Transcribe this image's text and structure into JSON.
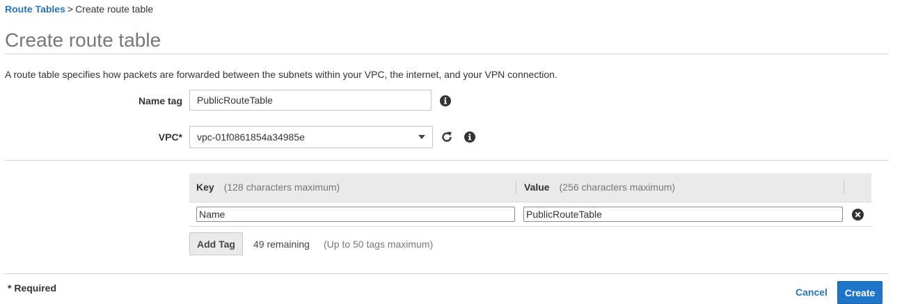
{
  "breadcrumb": {
    "parent": "Route Tables",
    "separator": ">",
    "current": "Create route table"
  },
  "page": {
    "title": "Create route table",
    "description": "A route table specifies how packets are forwarded between the subnets within your VPC, the internet, and your VPN connection."
  },
  "form": {
    "name_tag": {
      "label": "Name tag",
      "value": "PublicRouteTable"
    },
    "vpc": {
      "label": "VPC*",
      "selected": "vpc-01f0861854a34985e"
    }
  },
  "tags": {
    "key_header": "Key",
    "key_hint": "(128 characters maximum)",
    "value_header": "Value",
    "value_hint": "(256 characters maximum)",
    "rows": [
      {
        "key": "Name",
        "value": "PublicRouteTable"
      }
    ],
    "add_tag_label": "Add Tag",
    "remaining": "49 remaining",
    "max_hint": "(Up to 50 tags maximum)"
  },
  "footer": {
    "required_note": "* Required",
    "cancel_label": "Cancel",
    "create_label": "Create"
  },
  "colors": {
    "link": "#2a73b8",
    "primary_button": "#1f75c8",
    "header_bg": "#eaeaea"
  }
}
